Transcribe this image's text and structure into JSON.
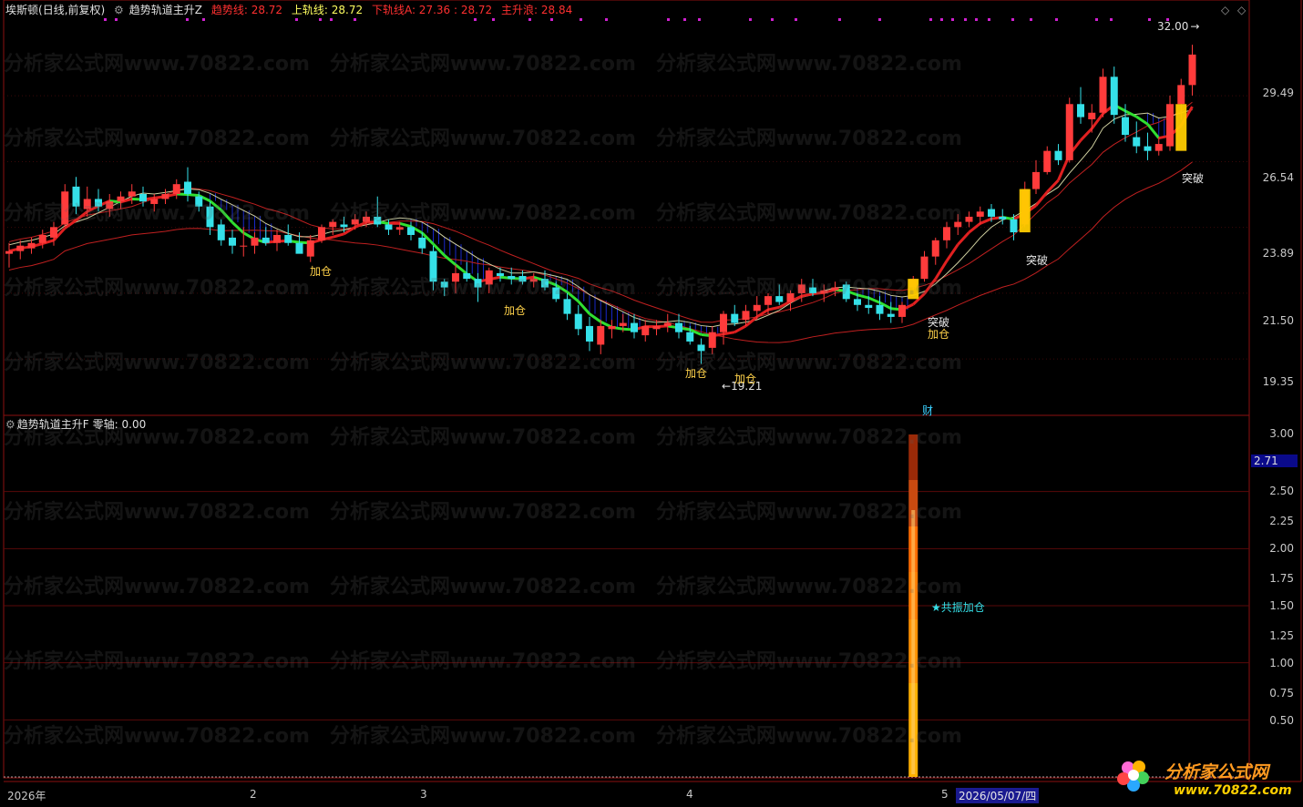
{
  "main_header": {
    "stock_name": "埃斯顿",
    "period": "(日线,前复权)",
    "indicator_name": "趋势轨道主升Z",
    "items": [
      {
        "label": "趋势线: 28.72",
        "color": "#ff3030"
      },
      {
        "label": "上轨线: 28.72",
        "color": "#ffff60"
      },
      {
        "label": "下轨线A: 27.36 : 28.72",
        "color": "#ff3030"
      },
      {
        "label": "主升浪: 28.84",
        "color": "#ff3030"
      }
    ]
  },
  "sub_header": {
    "indicator_name": "趋势轨道主升F",
    "zero_axis": "零轴: 0.00"
  },
  "main_y_axis": [
    "29.49",
    "26.54",
    "23.89",
    "21.50",
    "19.35"
  ],
  "sub_y_axis": [
    "3.00",
    "2.50",
    "2.25",
    "2.00",
    "1.75",
    "1.50",
    "1.25",
    "1.00",
    "0.75",
    "0.50"
  ],
  "sub_value_tag": "2.71",
  "x_axis": [
    "2026年",
    "2",
    "3",
    "4",
    "5"
  ],
  "cursor_date": "2026/05/07/四",
  "annotations": {
    "high": "32.00",
    "low": "19.21",
    "add_pos": "加仓",
    "breakout": "突破",
    "finance": "财",
    "resonance": "★共振加仓"
  },
  "watermark": "分析家公式网www.70822.com",
  "logo_text": "分析家公式网",
  "logo_url": "www.70822.com",
  "window_icons": [
    "diamond-icon",
    "chevron-icon",
    "close-icon"
  ],
  "colors": {
    "up": "#ff3b3b",
    "down": "#35e0e8",
    "trend_red": "#e02020",
    "trend_green": "#30e030",
    "band_red": "#c02020",
    "upper_band": "#d0d0a0",
    "hatch": "#1828c8",
    "panel_border": "#8b1010",
    "label_gold": "#ffd24a"
  },
  "chart_data": {
    "type": "candlestick",
    "title": "埃斯顿 (日线,前复权)",
    "ylim": [
      18.5,
      33.0
    ],
    "candles": [
      {
        "o": 22.9,
        "h": 23.3,
        "l": 22.4,
        "c": 23.0
      },
      {
        "o": 23.0,
        "h": 23.4,
        "l": 22.7,
        "c": 23.2
      },
      {
        "o": 23.1,
        "h": 23.5,
        "l": 22.9,
        "c": 23.3
      },
      {
        "o": 23.3,
        "h": 23.8,
        "l": 23.1,
        "c": 23.6
      },
      {
        "o": 23.5,
        "h": 24.1,
        "l": 23.2,
        "c": 23.9
      },
      {
        "o": 24.0,
        "h": 25.6,
        "l": 23.9,
        "c": 25.3
      },
      {
        "o": 25.5,
        "h": 25.9,
        "l": 24.4,
        "c": 24.7
      },
      {
        "o": 24.6,
        "h": 25.5,
        "l": 24.3,
        "c": 25.0
      },
      {
        "o": 25.0,
        "h": 25.4,
        "l": 24.5,
        "c": 24.7
      },
      {
        "o": 24.6,
        "h": 25.2,
        "l": 24.3,
        "c": 24.9
      },
      {
        "o": 24.9,
        "h": 25.3,
        "l": 24.6,
        "c": 25.1
      },
      {
        "o": 25.1,
        "h": 25.6,
        "l": 24.8,
        "c": 25.3
      },
      {
        "o": 25.2,
        "h": 25.5,
        "l": 24.7,
        "c": 24.9
      },
      {
        "o": 24.8,
        "h": 25.2,
        "l": 24.5,
        "c": 25.0
      },
      {
        "o": 25.0,
        "h": 25.4,
        "l": 24.8,
        "c": 25.2
      },
      {
        "o": 25.2,
        "h": 25.8,
        "l": 25.0,
        "c": 25.6
      },
      {
        "o": 25.7,
        "h": 26.3,
        "l": 24.9,
        "c": 25.2
      },
      {
        "o": 25.1,
        "h": 25.3,
        "l": 24.5,
        "c": 24.7
      },
      {
        "o": 24.7,
        "h": 24.9,
        "l": 23.6,
        "c": 23.9
      },
      {
        "o": 24.0,
        "h": 24.2,
        "l": 23.2,
        "c": 23.4
      },
      {
        "o": 23.5,
        "h": 23.8,
        "l": 22.9,
        "c": 23.2
      },
      {
        "o": 23.2,
        "h": 23.9,
        "l": 22.8,
        "c": 23.2
      },
      {
        "o": 23.2,
        "h": 23.7,
        "l": 22.9,
        "c": 23.5
      },
      {
        "o": 23.5,
        "h": 23.9,
        "l": 23.2,
        "c": 23.3
      },
      {
        "o": 23.3,
        "h": 23.8,
        "l": 23.0,
        "c": 23.6
      },
      {
        "o": 23.6,
        "h": 24.0,
        "l": 23.2,
        "c": 23.3
      },
      {
        "o": 23.3,
        "h": 23.7,
        "l": 23.0,
        "c": 22.9
      },
      {
        "o": 22.8,
        "h": 23.6,
        "l": 22.6,
        "c": 23.4
      },
      {
        "o": 23.4,
        "h": 24.0,
        "l": 23.3,
        "c": 23.9
      },
      {
        "o": 23.9,
        "h": 24.2,
        "l": 23.6,
        "c": 24.1
      },
      {
        "o": 24.0,
        "h": 24.3,
        "l": 23.7,
        "c": 23.9
      },
      {
        "o": 24.0,
        "h": 24.4,
        "l": 23.8,
        "c": 24.2
      },
      {
        "o": 24.1,
        "h": 24.5,
        "l": 23.9,
        "c": 24.3
      },
      {
        "o": 24.3,
        "h": 25.1,
        "l": 23.9,
        "c": 24.0
      },
      {
        "o": 24.0,
        "h": 24.2,
        "l": 23.6,
        "c": 23.8
      },
      {
        "o": 23.8,
        "h": 24.1,
        "l": 23.6,
        "c": 23.9
      },
      {
        "o": 23.9,
        "h": 24.1,
        "l": 23.4,
        "c": 23.6
      },
      {
        "o": 23.5,
        "h": 23.7,
        "l": 22.9,
        "c": 23.1
      },
      {
        "o": 23.0,
        "h": 23.2,
        "l": 21.6,
        "c": 21.9
      },
      {
        "o": 21.9,
        "h": 22.0,
        "l": 21.4,
        "c": 21.7
      },
      {
        "o": 21.9,
        "h": 22.5,
        "l": 21.5,
        "c": 22.2
      },
      {
        "o": 22.2,
        "h": 22.6,
        "l": 21.9,
        "c": 22.0
      },
      {
        "o": 22.0,
        "h": 22.2,
        "l": 21.2,
        "c": 21.7
      },
      {
        "o": 21.8,
        "h": 22.4,
        "l": 21.5,
        "c": 22.3
      },
      {
        "o": 22.2,
        "h": 22.4,
        "l": 21.9,
        "c": 22.1
      },
      {
        "o": 22.1,
        "h": 22.4,
        "l": 21.8,
        "c": 22.0
      },
      {
        "o": 22.1,
        "h": 22.3,
        "l": 21.8,
        "c": 21.9
      },
      {
        "o": 21.9,
        "h": 22.2,
        "l": 21.7,
        "c": 22.0
      },
      {
        "o": 22.0,
        "h": 22.3,
        "l": 21.6,
        "c": 21.7
      },
      {
        "o": 21.7,
        "h": 21.9,
        "l": 21.2,
        "c": 21.3
      },
      {
        "o": 21.3,
        "h": 21.5,
        "l": 20.6,
        "c": 20.8
      },
      {
        "o": 20.8,
        "h": 21.1,
        "l": 20.1,
        "c": 20.3
      },
      {
        "o": 20.4,
        "h": 20.7,
        "l": 19.6,
        "c": 19.9
      },
      {
        "o": 19.8,
        "h": 20.6,
        "l": 19.5,
        "c": 20.4
      },
      {
        "o": 20.3,
        "h": 20.6,
        "l": 20.0,
        "c": 20.4
      },
      {
        "o": 20.4,
        "h": 20.8,
        "l": 20.2,
        "c": 20.5
      },
      {
        "o": 20.5,
        "h": 20.8,
        "l": 20.0,
        "c": 20.2
      },
      {
        "o": 20.1,
        "h": 20.6,
        "l": 19.9,
        "c": 20.4
      },
      {
        "o": 20.3,
        "h": 20.6,
        "l": 20.1,
        "c": 20.4
      },
      {
        "o": 20.4,
        "h": 20.8,
        "l": 20.2,
        "c": 20.5
      },
      {
        "o": 20.5,
        "h": 20.8,
        "l": 20.0,
        "c": 20.2
      },
      {
        "o": 20.2,
        "h": 20.4,
        "l": 19.8,
        "c": 19.9
      },
      {
        "o": 19.8,
        "h": 20.0,
        "l": 19.2,
        "c": 19.6
      },
      {
        "o": 19.7,
        "h": 20.4,
        "l": 19.5,
        "c": 20.2
      },
      {
        "o": 20.2,
        "h": 20.9,
        "l": 19.8,
        "c": 20.8
      },
      {
        "o": 20.8,
        "h": 21.1,
        "l": 20.4,
        "c": 20.5
      },
      {
        "o": 20.6,
        "h": 21.1,
        "l": 20.4,
        "c": 20.9
      },
      {
        "o": 20.9,
        "h": 21.4,
        "l": 20.6,
        "c": 21.1
      },
      {
        "o": 21.1,
        "h": 21.5,
        "l": 20.8,
        "c": 21.4
      },
      {
        "o": 21.4,
        "h": 21.8,
        "l": 21.1,
        "c": 21.2
      },
      {
        "o": 21.2,
        "h": 21.6,
        "l": 20.9,
        "c": 21.5
      },
      {
        "o": 21.5,
        "h": 22.0,
        "l": 21.2,
        "c": 21.8
      },
      {
        "o": 21.7,
        "h": 22.0,
        "l": 21.4,
        "c": 21.5
      },
      {
        "o": 21.5,
        "h": 21.8,
        "l": 21.2,
        "c": 21.6
      },
      {
        "o": 21.6,
        "h": 21.9,
        "l": 21.4,
        "c": 21.7
      },
      {
        "o": 21.8,
        "h": 21.9,
        "l": 21.2,
        "c": 21.3
      },
      {
        "o": 21.3,
        "h": 21.5,
        "l": 20.9,
        "c": 21.1
      },
      {
        "o": 21.1,
        "h": 21.4,
        "l": 20.8,
        "c": 21.0
      },
      {
        "o": 21.1,
        "h": 21.4,
        "l": 20.6,
        "c": 20.8
      },
      {
        "o": 20.8,
        "h": 21.2,
        "l": 20.5,
        "c": 20.7
      },
      {
        "o": 20.7,
        "h": 21.2,
        "l": 20.5,
        "c": 21.1
      },
      {
        "o": 21.7,
        "h": 22.1,
        "l": 21.4,
        "c": 22.0
      },
      {
        "o": 22.0,
        "h": 23.0,
        "l": 21.9,
        "c": 22.8
      },
      {
        "o": 22.8,
        "h": 23.5,
        "l": 22.5,
        "c": 23.4
      },
      {
        "o": 23.4,
        "h": 24.1,
        "l": 23.1,
        "c": 23.9
      },
      {
        "o": 23.9,
        "h": 24.4,
        "l": 23.6,
        "c": 24.1
      },
      {
        "o": 24.1,
        "h": 24.5,
        "l": 23.9,
        "c": 24.3
      },
      {
        "o": 24.3,
        "h": 24.7,
        "l": 24.0,
        "c": 24.5
      },
      {
        "o": 24.6,
        "h": 24.8,
        "l": 24.1,
        "c": 24.3
      },
      {
        "o": 24.3,
        "h": 24.6,
        "l": 24.0,
        "c": 24.2
      },
      {
        "o": 24.2,
        "h": 24.4,
        "l": 23.4,
        "c": 23.7
      },
      {
        "o": 24.0,
        "h": 25.7,
        "l": 23.9,
        "c": 25.4
      },
      {
        "o": 25.4,
        "h": 26.6,
        "l": 25.2,
        "c": 26.1
      },
      {
        "o": 26.1,
        "h": 27.2,
        "l": 26.0,
        "c": 27.0
      },
      {
        "o": 27.0,
        "h": 27.3,
        "l": 26.4,
        "c": 26.6
      },
      {
        "o": 26.6,
        "h": 29.4,
        "l": 26.5,
        "c": 29.1
      },
      {
        "o": 29.1,
        "h": 29.9,
        "l": 28.2,
        "c": 28.5
      },
      {
        "o": 28.4,
        "h": 29.1,
        "l": 27.8,
        "c": 28.7
      },
      {
        "o": 28.7,
        "h": 30.8,
        "l": 28.5,
        "c": 30.4
      },
      {
        "o": 30.4,
        "h": 30.9,
        "l": 28.2,
        "c": 28.6
      },
      {
        "o": 28.5,
        "h": 29.1,
        "l": 27.4,
        "c": 27.7
      },
      {
        "o": 27.6,
        "h": 28.3,
        "l": 26.9,
        "c": 27.2
      },
      {
        "o": 27.2,
        "h": 27.8,
        "l": 26.6,
        "c": 27.0
      },
      {
        "o": 27.0,
        "h": 27.6,
        "l": 26.8,
        "c": 27.3
      },
      {
        "o": 27.2,
        "h": 29.5,
        "l": 27.0,
        "c": 29.1
      },
      {
        "o": 29.1,
        "h": 30.3,
        "l": 28.4,
        "c": 30.0
      },
      {
        "o": 30.0,
        "h": 32.0,
        "l": 29.5,
        "c": 31.5
      }
    ],
    "sub_series": {
      "name": "趋势轨道主升F",
      "value": 3.0,
      "bar_index": 81
    }
  }
}
